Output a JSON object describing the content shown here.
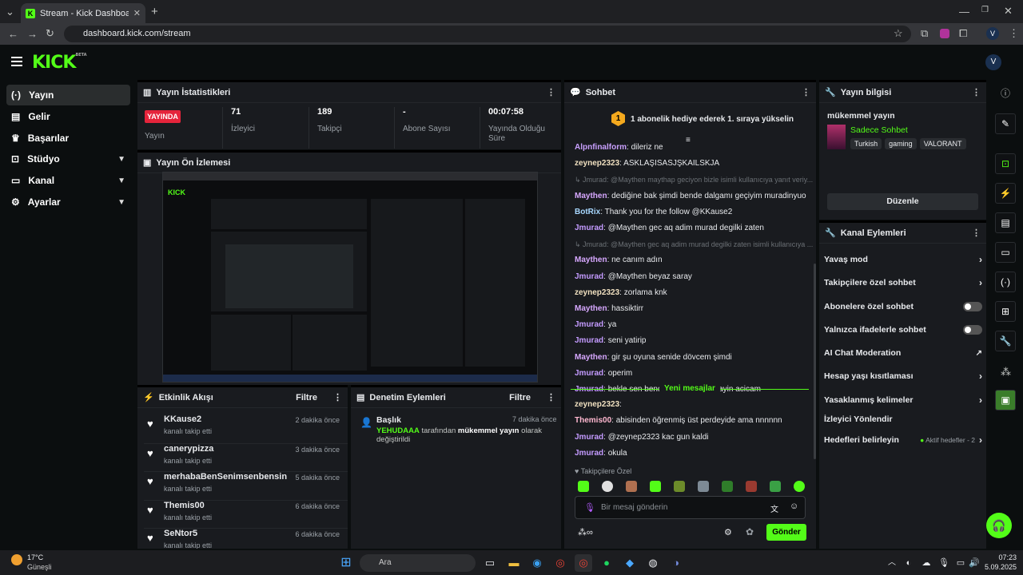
{
  "browser": {
    "tab_title": "Stream - Kick Dashboard",
    "url": "dashboard.kick.com/stream",
    "new_tab": "+"
  },
  "logo": {
    "text": "KICK",
    "badge": "BETA"
  },
  "sidebar": [
    {
      "label": "Yayın",
      "icon": "broadcast-icon"
    },
    {
      "label": "Gelir",
      "icon": "revenue-icon"
    },
    {
      "label": "Başarılar",
      "icon": "trophy-icon"
    },
    {
      "label": "Stüdyo",
      "icon": "studio-icon"
    },
    {
      "label": "Kanal",
      "icon": "channel-icon"
    },
    {
      "label": "Ayarlar",
      "icon": "settings-icon"
    }
  ],
  "stats": {
    "title": "Yayın İstatistikleri",
    "live_badge": "YAYINDA",
    "live_label": "Yayın",
    "viewers_value": "71",
    "viewers_label": "İzleyici",
    "followers_value": "189",
    "followers_label": "Takipçi",
    "subs_value": "-",
    "subs_label": "Abone Sayısı",
    "duration_value": "00:07:58",
    "duration_label": "Yayında Olduğu Süre"
  },
  "preview": {
    "title": "Yayın Ön İzlemesi"
  },
  "activity": {
    "title": "Etkinlik Akışı",
    "filter": "Filtre",
    "items": [
      {
        "name": "KKause2",
        "sub": "kanalı takip etti",
        "time": "2 dakika önce"
      },
      {
        "name": "canerypizza",
        "sub": "kanalı takip etti",
        "time": "3 dakika önce"
      },
      {
        "name": "merhabaBenSenimsenbensin",
        "sub": "kanalı takip etti",
        "time": "5 dakika önce"
      },
      {
        "name": "Themis00",
        "sub": "kanalı takip etti",
        "time": "6 dakika önce"
      },
      {
        "name": "SeNtor5",
        "sub": "kanalı takip etti",
        "time": "6 dakika önce"
      }
    ]
  },
  "moderation": {
    "title": "Denetim Eylemleri",
    "filter": "Filtre",
    "item_title": "Başlık",
    "item_time": "7 dakika önce",
    "item_user": "YEHUDAAA",
    "item_mid": " tarafından ",
    "item_bold": "mükemmel yayın",
    "item_end": " olarak değiştirildi"
  },
  "chat": {
    "title": "Sohbet",
    "pinned_rank": "1",
    "pinned": "1 abonelik hediye ederek 1. sıraya yükselin",
    "new_messages": "Yeni mesajlar",
    "followers_only": "Takipçilere Özel",
    "placeholder": "Bir mesaj gönderin",
    "send": "Gönder",
    "messages": [
      {
        "user": "Alpnfinalform",
        "text": "dileriz ne",
        "color": "#c9a0ff"
      },
      {
        "user": "zeynep2323",
        "text": "ASKLAŞISASJŞKAILSKJA",
        "color": "#f0e0c0"
      },
      {
        "reply": "Jmurad: @Maythen maythap geciyon bizle isimli kullanıcıya yanıt veriy..."
      },
      {
        "user": "Maythen",
        "text": "dediğine bak şimdi bende dalgamı geçiyim muradinyuo",
        "color": "#d7a8ff"
      },
      {
        "user": "BotRix",
        "text": "Thank you for the follow @KKause2",
        "color": "#a8d8ff"
      },
      {
        "user": "Jmurad",
        "text": "@Maythen gec aq adim murad degilki zaten",
        "color": "#c49bff"
      },
      {
        "reply": "Jmurad: @Maythen gec aq adim murad degilki zaten isimli kullanıcıya ..."
      },
      {
        "user": "Maythen",
        "text": "ne canım adın",
        "color": "#d7a8ff"
      },
      {
        "user": "Jmurad",
        "text": "@Maythen beyaz saray",
        "color": "#c49bff"
      },
      {
        "user": "zeynep2323",
        "text": "zorlama knk",
        "color": "#f0e0c0"
      },
      {
        "user": "Maythen",
        "text": "hassiktirr",
        "color": "#d7a8ff"
      },
      {
        "user": "Jmurad",
        "text": "ya",
        "color": "#c49bff"
      },
      {
        "user": "Jmurad",
        "text": "seni yatirip",
        "color": "#c49bff"
      },
      {
        "user": "Maythen",
        "text": "gir şu oyuna senide dövcem şimdi",
        "color": "#d7a8ff"
      },
      {
        "user": "Jmurad",
        "text": "operim",
        "color": "#c49bff"
      },
      {
        "user": "Jmurad",
        "text": "bekle sen bende sevgili yapip yayin acicam",
        "color": "#c49bff"
      }
    ],
    "messages2": [
      {
        "user": "zeynep2323",
        "text": "",
        "color": "#f0e0c0"
      },
      {
        "user": "Themis00",
        "text": "abisinden öğrenmiş üst perdeyide ama nnnnnn",
        "color": "#ffb8d0"
      },
      {
        "user": "Jmurad",
        "text": "@zeynep2323 kac gun kaldi",
        "color": "#c49bff"
      },
      {
        "user": "Jmurad",
        "text": "okula",
        "color": "#c49bff"
      }
    ]
  },
  "info": {
    "title": "Yayın bilgisi",
    "stream_title": "mükemmel yayın",
    "category": "Sadece Sohbet",
    "tags": [
      "Turkish",
      "gaming",
      "VALORANT"
    ],
    "edit": "Düzenle"
  },
  "actions": {
    "title": "Kanal Eylemleri",
    "items": [
      {
        "label": "Yavaş mod",
        "type": "arrow"
      },
      {
        "label": "Takipçilere özel sohbet",
        "type": "arrow"
      },
      {
        "label": "Abonelere özel sohbet",
        "type": "toggle"
      },
      {
        "label": "Yalnızca ifadelerle sohbet",
        "type": "toggle"
      },
      {
        "label": "AI Chat Moderation",
        "type": "link"
      },
      {
        "label": "Hesap yaşı kısıtlaması",
        "type": "arrow"
      },
      {
        "label": "Yasaklanmış kelimeler",
        "type": "arrow"
      },
      {
        "label": "İzleyici Yönlendir",
        "type": "none"
      },
      {
        "label": "Hedefleri belirleyin",
        "type": "arrow",
        "extra": "Aktif hedefler - 2"
      }
    ]
  },
  "taskbar": {
    "temp": "17°C",
    "weather": "Güneşli",
    "search": "Ara",
    "time": "07:23",
    "date": "5.09.2025"
  }
}
